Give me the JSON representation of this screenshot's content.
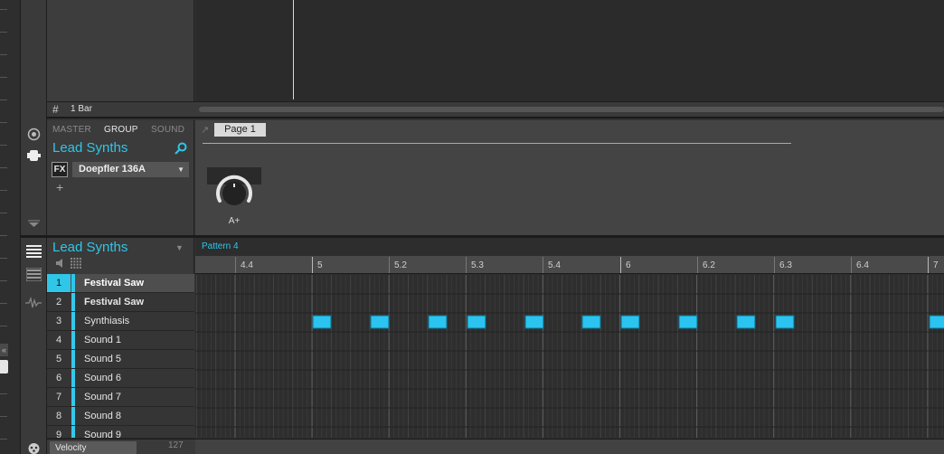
{
  "arranger": {
    "bar_size_label": "1 Bar"
  },
  "plugin_panel": {
    "tabs": [
      {
        "label": "MASTER",
        "active": false
      },
      {
        "label": "GROUP",
        "active": true
      },
      {
        "label": "SOUND",
        "active": false
      }
    ],
    "group_name": "Lead Synths",
    "fx_badge": "FX",
    "plugin_name": "Doepfler 136A",
    "add_symbol": "+",
    "page_label": "Page 1",
    "knob_label": "A+"
  },
  "pattern_editor": {
    "group_name": "Lead Synths",
    "pattern_name": "Pattern 4",
    "ruler_labels": [
      "4.4",
      "5",
      "5.2",
      "5.3",
      "5.4",
      "6",
      "6.2",
      "6.3",
      "6.4",
      "7"
    ],
    "sounds": [
      {
        "num": "1",
        "name": "Festival Saw",
        "selected": true
      },
      {
        "num": "2",
        "name": "Festival Saw",
        "selected": false
      },
      {
        "num": "3",
        "name": "Synthiasis",
        "selected": false
      },
      {
        "num": "4",
        "name": "Sound 1",
        "selected": false
      },
      {
        "num": "5",
        "name": "Sound 5",
        "selected": false
      },
      {
        "num": "6",
        "name": "Sound 6",
        "selected": false
      },
      {
        "num": "7",
        "name": "Sound 7",
        "selected": false
      },
      {
        "num": "8",
        "name": "Sound 8",
        "selected": false
      },
      {
        "num": "9",
        "name": "Sound 9",
        "selected": false
      }
    ],
    "notes_row": 3,
    "velocity_label": "Velocity",
    "velocity_max": "127"
  },
  "colors": {
    "accent": "#2fc6e8",
    "note": "#2bc3ef",
    "background": "#333333"
  },
  "icons": [
    "grid-icon",
    "search-icon",
    "mute-icon",
    "step-grid-icon",
    "plugin-icon",
    "macro-icon",
    "list-icon",
    "keyboard-icon",
    "waveform-icon",
    "drum-icon"
  ]
}
